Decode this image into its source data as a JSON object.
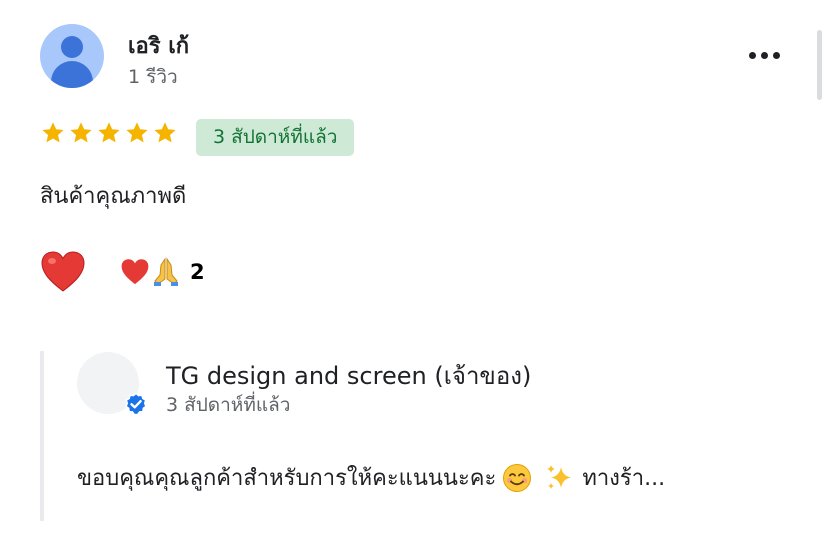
{
  "review": {
    "reviewer_name": "เอริ เก้",
    "review_count": "1 รีวิว",
    "rating": 5,
    "time_ago": "3 สัปดาห์ที่แล้ว",
    "text": "สินค้าคุณภาพดี",
    "reaction_count": "2"
  },
  "owner_reply": {
    "name": "TG design and screen (เจ้าของ)",
    "time_ago": "3 สัปดาห์ที่แล้ว",
    "text_before_emoji": "ขอบคุณคุณลูกค้าสำหรับการให้คะแนนนะคะ",
    "text_after_emoji": "ทางร้า..."
  },
  "colors": {
    "star": "#f4b400",
    "badge_bg": "#ceead6",
    "badge_text": "#137333",
    "heart": "#e53935",
    "verified": "#1a73e8",
    "avatar_bg": "#a8c7fa",
    "avatar_fg": "#3b73d9"
  },
  "icons": [
    "person-avatar-icon",
    "more-options-icon",
    "star-icon",
    "heart-icon",
    "pray-icon",
    "verified-icon",
    "smiling-face-icon",
    "sparkles-icon"
  ]
}
